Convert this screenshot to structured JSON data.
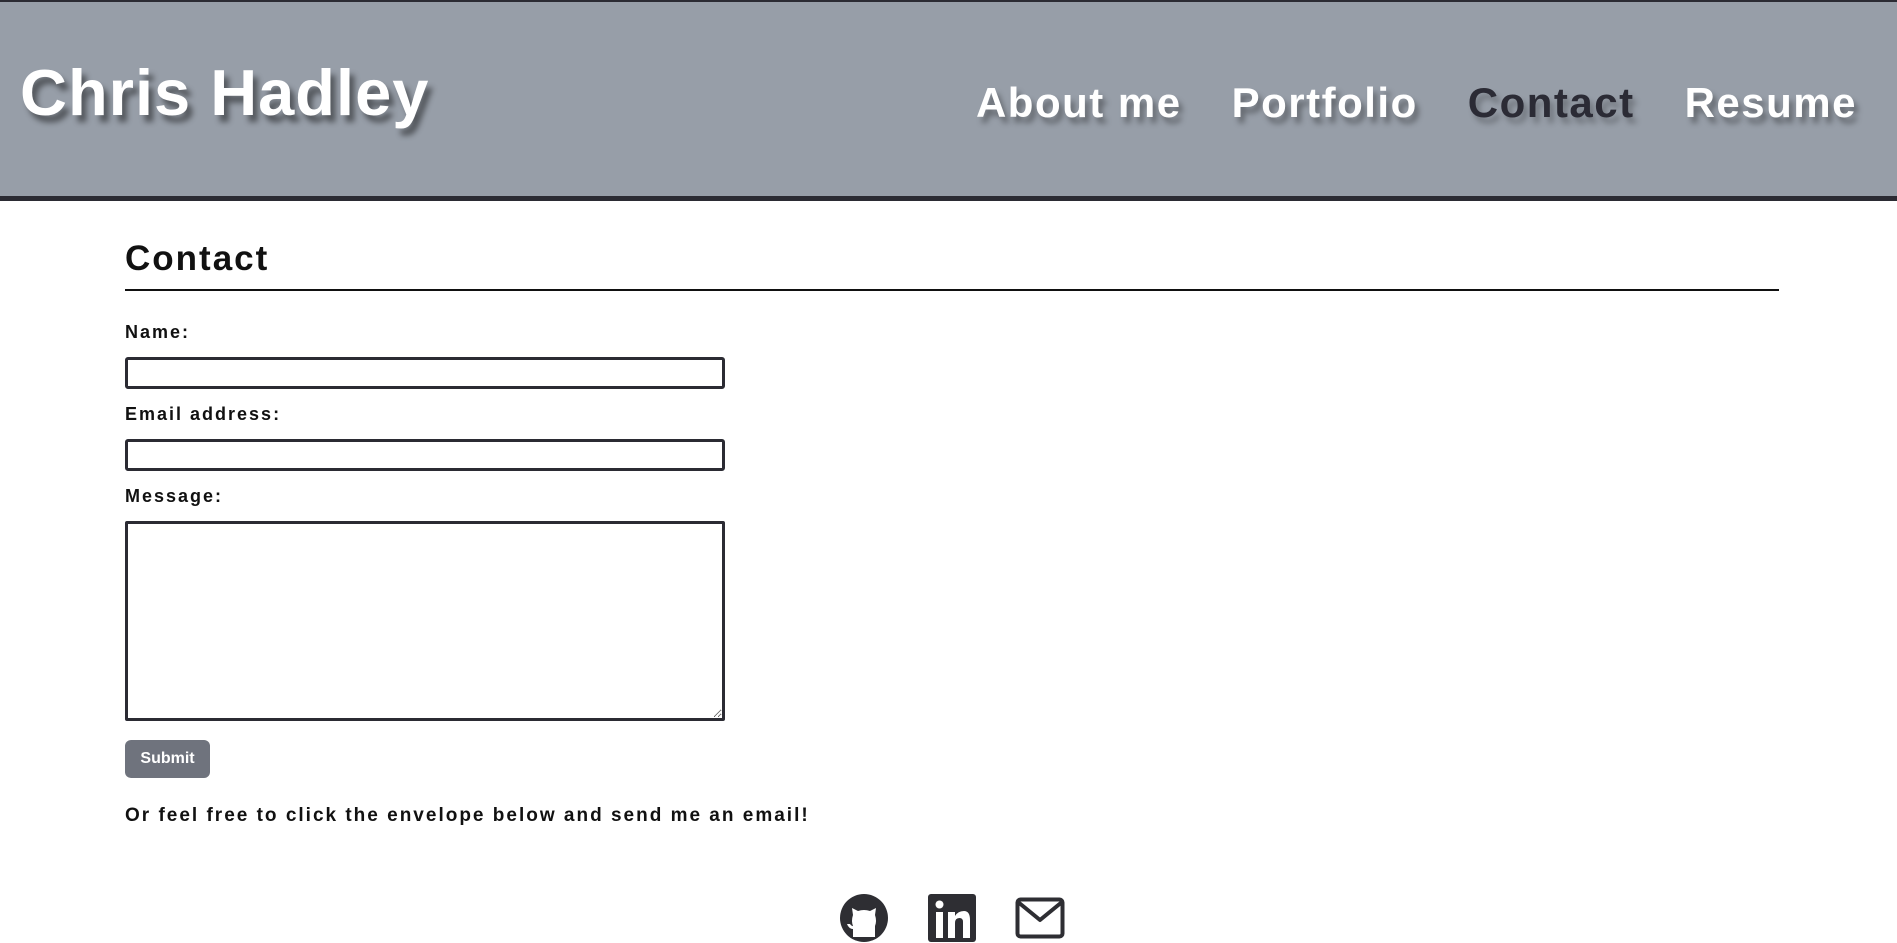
{
  "header": {
    "brand": "Chris Hadley",
    "nav": [
      {
        "label": "About me",
        "active": false
      },
      {
        "label": "Portfolio",
        "active": false
      },
      {
        "label": "Contact",
        "active": true
      },
      {
        "label": "Resume",
        "active": false
      }
    ]
  },
  "main": {
    "title": "Contact",
    "form": {
      "name_label": "Name:",
      "name_value": "",
      "email_label": "Email address:",
      "email_value": "",
      "message_label": "Message:",
      "message_value": "",
      "submit_label": "Submit"
    },
    "note": "Or feel free to click the envelope below and send me an email!"
  },
  "footer": {
    "socials": [
      {
        "icon": "github-icon"
      },
      {
        "icon": "linkedin-icon"
      },
      {
        "icon": "envelope-icon"
      }
    ]
  },
  "colors": {
    "header_bg": "#979ea8",
    "header_border": "#2b2b33",
    "active_nav": "#2b2b35",
    "submit_bg": "#6f737d",
    "icon": "#2e2e33"
  }
}
